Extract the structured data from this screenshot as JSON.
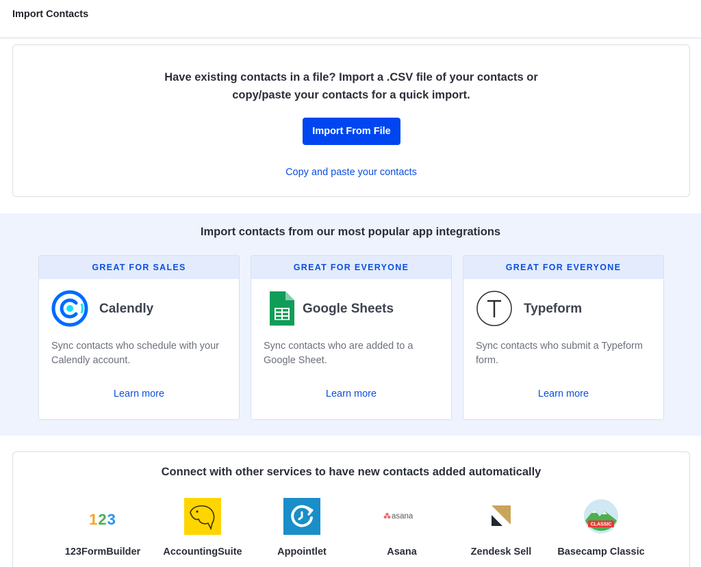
{
  "header": {
    "title": "Import Contacts"
  },
  "file_import": {
    "headline_line1": "Have existing contacts in a file? Import a .CSV file of your contacts or",
    "headline_line2": "copy/paste your contacts for a quick import.",
    "button_label": "Import From File",
    "paste_link": "Copy and paste your contacts"
  },
  "popular": {
    "title": "Import contacts from our most popular app integrations",
    "cards": [
      {
        "banner": "GREAT FOR SALES",
        "name": "Calendly",
        "icon": "calendly-logo-icon",
        "description": "Sync contacts who schedule with your Calendly account.",
        "link": "Learn more"
      },
      {
        "banner": "GREAT FOR EVERYONE",
        "name": "Google Sheets",
        "icon": "google-sheets-logo-icon",
        "description": "Sync contacts who are added to a Google Sheet.",
        "link": "Learn more"
      },
      {
        "banner": "GREAT FOR EVERYONE",
        "name": "Typeform",
        "icon": "typeform-logo-icon",
        "description": "Sync contacts who submit a Typeform form.",
        "link": "Learn more"
      }
    ]
  },
  "services": {
    "title": "Connect with other services to have new contacts added automatically",
    "items": [
      {
        "name": "123FormBuilder",
        "icon": "123formbuilder-logo-icon"
      },
      {
        "name": "AccountingSuite",
        "icon": "accountingsuite-logo-icon"
      },
      {
        "name": "Appointlet",
        "icon": "appointlet-logo-icon"
      },
      {
        "name": "Asana",
        "icon": "asana-logo-icon",
        "logo_text": "asana"
      },
      {
        "name": "Zendesk Sell",
        "icon": "zendesk-sell-logo-icon"
      },
      {
        "name": "Basecamp Classic",
        "icon": "basecamp-classic-logo-icon",
        "logo_text": "CLASSIC"
      }
    ]
  },
  "colors": {
    "primary": "#0046f0",
    "link": "#0b4fe0",
    "section_bg": "#eef3fd",
    "banner_bg": "#e3ebfd"
  }
}
